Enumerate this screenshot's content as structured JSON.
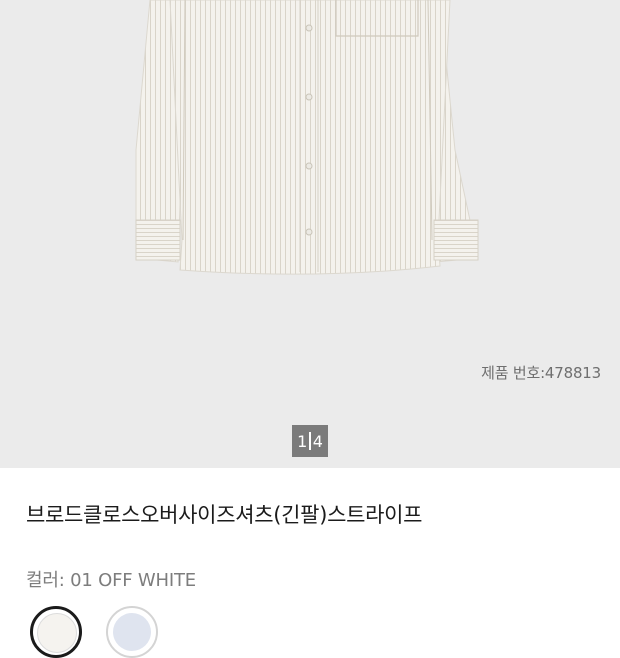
{
  "gallery": {
    "image_alt": "white striped shirt",
    "product_number": "제품 번호:478813",
    "pager_current": "1",
    "pager_total": "4"
  },
  "product": {
    "name": "브로드클로스오버사이즈셔츠(긴팔)스트라이프",
    "color_line": "컬러: 01 OFF WHITE"
  },
  "swatches": [
    {
      "name": "off-white",
      "color": "#f5f3ef",
      "selected": true
    },
    {
      "name": "blue",
      "color": "#dfe4ef",
      "selected": false
    }
  ],
  "colors": {
    "hero_bg": "#ebebeb",
    "shirt": "#f3f1ec",
    "stripe": "#d6d1c6"
  }
}
